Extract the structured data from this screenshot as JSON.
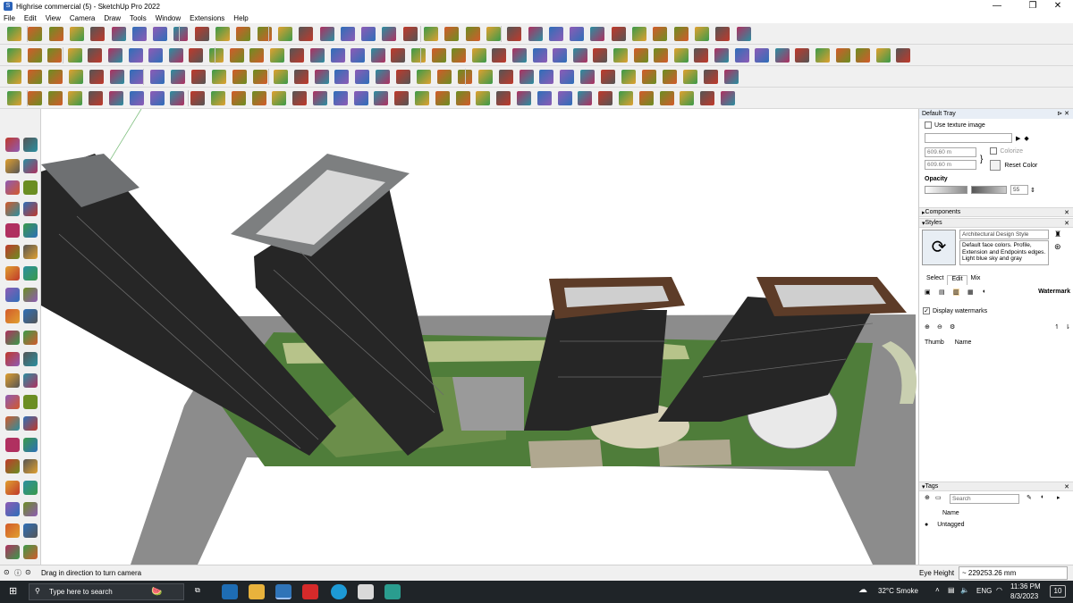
{
  "window": {
    "title": "Highrise commercial (5) - SketchUp Pro 2022",
    "minimize": "—",
    "maximize": "❐",
    "close": "✕"
  },
  "menu": [
    "File",
    "Edit",
    "View",
    "Camera",
    "Draw",
    "Tools",
    "Window",
    "Extensions",
    "Help"
  ],
  "tray": {
    "title": "Default Tray",
    "pin": "⊳",
    "close": "✕",
    "materials": {
      "use_texture_label": "Use texture image",
      "width_value": "609.60 m",
      "height_value": "609.60 m",
      "colorize_label": "Colorize",
      "reset_color_label": "Reset Color",
      "opacity_label": "Opacity",
      "opacity_value": "55"
    },
    "components_label": "Components",
    "styles": {
      "label": "Styles",
      "style_name": "Architectural Design Style",
      "style_description": "Default face colors. Profile, Extension and Endpoints edges. Light blue sky and gray",
      "tabs": [
        "Select",
        "Edit",
        "Mix"
      ],
      "active_tab": "Edit",
      "watermark_label": "Watermark",
      "display_watermarks_label": "Display watermarks",
      "col_thumb": "Thumb",
      "col_name": "Name"
    },
    "tags": {
      "label": "Tags",
      "search_placeholder": "Search",
      "col_name": "Name",
      "row": "Untagged"
    }
  },
  "status": {
    "message": "Drag in direction to turn camera",
    "measure_label": "Eye Height",
    "measure_value": "~ 229253.26 mm"
  },
  "taskbar": {
    "search_placeholder": "Type here to search",
    "weather": "32°C  Smoke",
    "language": "ENG",
    "time": "11:36 PM",
    "date": "8/3/2023",
    "notification_count": "10"
  },
  "colors": {
    "ground_gray": "#8c8c8c",
    "tower_dark": "#262626",
    "roof_gray": "#7d7f80",
    "roof_brown": "#5d3c28",
    "landscape_green": "#4f7d3a",
    "tray_header": "#e8eef6",
    "taskbar": "#1f2428"
  }
}
